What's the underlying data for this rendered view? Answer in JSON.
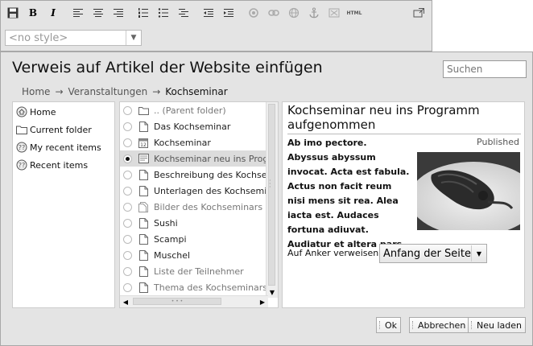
{
  "toolbar": {
    "buttons": [
      "save-icon",
      "bold-icon",
      "italic-icon",
      "align-left-icon",
      "align-center-icon",
      "align-right-icon",
      "numbered-list-icon",
      "bullet-list-icon",
      "definition-list-icon",
      "outdent-icon",
      "indent-icon",
      "insert-image-icon",
      "insert-link-icon",
      "external-link-icon",
      "anchor-icon",
      "insert-table-icon",
      "html-source-icon",
      "fullscreen-icon"
    ],
    "bold_label": "B",
    "italic_label": "I",
    "html_label": "HTML",
    "style_select": {
      "value": "<no style>"
    }
  },
  "dialog": {
    "title": "Verweis auf Artikel der Website einfügen",
    "search": {
      "placeholder": "Suchen"
    },
    "breadcrumb": {
      "items": [
        "Home",
        "Veranstaltungen",
        "Kochseminar"
      ],
      "separator": "→"
    },
    "sources": [
      {
        "label": "Home",
        "icon": "home-icon"
      },
      {
        "label": "Current folder",
        "icon": "folder-icon"
      },
      {
        "label": "My recent items",
        "icon": "recent-icon"
      },
      {
        "label": "Recent items",
        "icon": "recent-icon"
      }
    ],
    "items": [
      {
        "label": ".. (Parent folder)",
        "icon": "folder-icon",
        "checked": false,
        "dim": true
      },
      {
        "label": "Das Kochseminar",
        "icon": "document-icon",
        "checked": false,
        "dim": false
      },
      {
        "label": "Kochseminar",
        "icon": "event-icon",
        "checked": false,
        "dim": false
      },
      {
        "label": "Kochseminar neu ins Programm aufgenommen",
        "icon": "news-icon",
        "checked": true,
        "selected": true,
        "dim": false
      },
      {
        "label": "Beschreibung des Kochseminars",
        "icon": "document-icon",
        "checked": false,
        "dim": false
      },
      {
        "label": "Unterlagen des Kochseminars",
        "icon": "document-icon",
        "checked": false,
        "dim": false
      },
      {
        "label": "Bilder des Kochseminars",
        "icon": "images-icon",
        "checked": false,
        "dim": true
      },
      {
        "label": "Sushi",
        "icon": "document-icon",
        "checked": false,
        "dim": false
      },
      {
        "label": "Scampi",
        "icon": "document-icon",
        "checked": false,
        "dim": false
      },
      {
        "label": "Muschel",
        "icon": "document-icon",
        "checked": false,
        "dim": false
      },
      {
        "label": "Liste der Teilnehmer",
        "icon": "document-icon",
        "checked": false,
        "dim": true
      },
      {
        "label": "Thema des Kochseminars",
        "icon": "document-icon",
        "checked": false,
        "dim": true
      }
    ],
    "preview": {
      "title": "Kochseminar neu ins Programm aufgenommen",
      "status": "Published",
      "description": "Ab imo pectore. Abyssus abyssum invocat. Acta est fabula. Actus non facit reum nisi mens sit rea. Alea iacta est. Audaces fortuna adiuvat. Audiatur et altera pars.",
      "anchor_label": "Auf Anker verweisen",
      "anchor_value": "Anfang der Seite"
    },
    "buttons": {
      "ok": "Ok",
      "cancel": "Abbrechen",
      "reload": "Neu laden"
    }
  }
}
